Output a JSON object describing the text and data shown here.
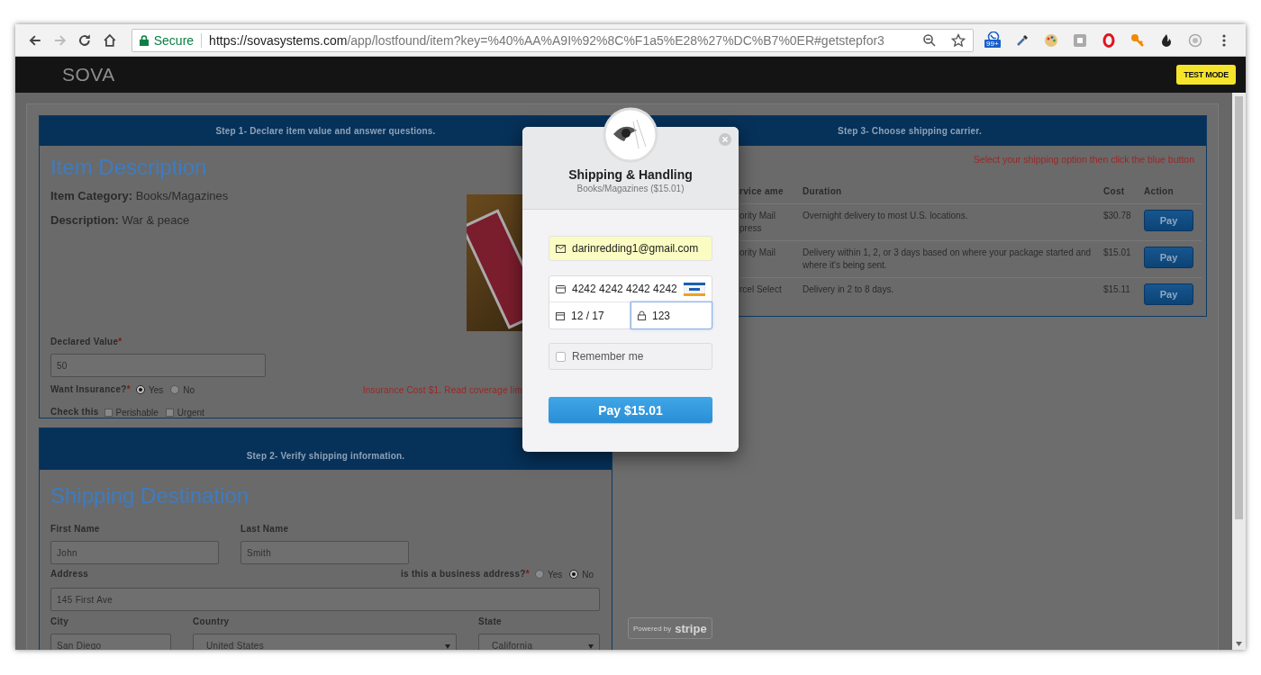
{
  "browser": {
    "secure_label": "Secure",
    "url_host": "https://sovasystems.com",
    "url_path": "/app/lostfound/item?key=%40%AA%A9I%92%8C%F1a5%E28%27%DC%B7%0ER#getstepfor3",
    "forward_disabled": true,
    "extension_badge": "99+"
  },
  "app_header": {
    "logo": "SOVA",
    "mode_badge": "TEST MODE"
  },
  "step1": {
    "header": "Step 1- Declare item value and answer questions.",
    "title": "Item Description",
    "details": [
      "**Item Category:** Books/Magazines",
      "**Description:** War & peace"
    ],
    "declared_value": {
      "label": "Declared Value",
      "required_mark": "*",
      "value": "50"
    },
    "insurance": {
      "label": "Want Insurance?",
      "required_mark": "*",
      "note": "Insurance Cost $1. Read coverage lim",
      "options": [
        {
          "label": "Yes",
          "selected": true
        },
        {
          "label": "No",
          "selected": false
        }
      ]
    },
    "check": {
      "label": "Check this",
      "options": [
        {
          "label": "Perishable",
          "checked": false
        },
        {
          "label": "Urgent",
          "checked": false
        }
      ]
    }
  },
  "step2": {
    "header": "Step 2- Verify shipping information.",
    "title": "Shipping Destination",
    "first_name": {
      "label": "First Name",
      "value": "John"
    },
    "last_name": {
      "label": "Last Name",
      "value": "Smith"
    },
    "address": {
      "label": "Address",
      "value": "145 First Ave"
    },
    "business": {
      "label": "is this a business address?",
      "required_mark": "*",
      "options": [
        {
          "label": "Yes",
          "selected": false
        },
        {
          "label": "No",
          "selected": true
        }
      ]
    },
    "city": {
      "label": "City",
      "value": "San Diego"
    },
    "country": {
      "label": "Country",
      "value": "United States"
    },
    "state": {
      "label": "State",
      "value": "California"
    }
  },
  "step3": {
    "header": "Step 3- Choose shipping carrier.",
    "hint": "Select your shipping option then click the blue button",
    "columns": [
      "rvice ame",
      "Duration",
      "Cost",
      "Action"
    ],
    "rows": [
      {
        "service": "ority Mail press",
        "duration": "Overnight delivery to most U.S. locations.",
        "cost": "$30.78",
        "action": "Pay"
      },
      {
        "service": "ority Mail",
        "duration": "Delivery within 1, 2, or 3 days based on where your package started and where it's being sent.",
        "cost": "$15.01",
        "action": "Pay"
      },
      {
        "service": "rcel Select",
        "duration": "Delivery in 2 to 8 days.",
        "cost": "$15.11",
        "action": "Pay"
      }
    ]
  },
  "modal": {
    "title": "Shipping & Handling",
    "subtitle": "Books/Magazines ($15.01)",
    "email": "darinredding1@gmail.com",
    "card_number": "4242 4242 4242 4242",
    "expiry": "12 / 17",
    "cvc": "123",
    "cvc_focused": true,
    "remember": {
      "label": "Remember me",
      "checked": false
    },
    "pay_button": "Pay $15.01"
  },
  "stripe_badge": {
    "prefix": "Powered by",
    "brand": "stripe"
  }
}
